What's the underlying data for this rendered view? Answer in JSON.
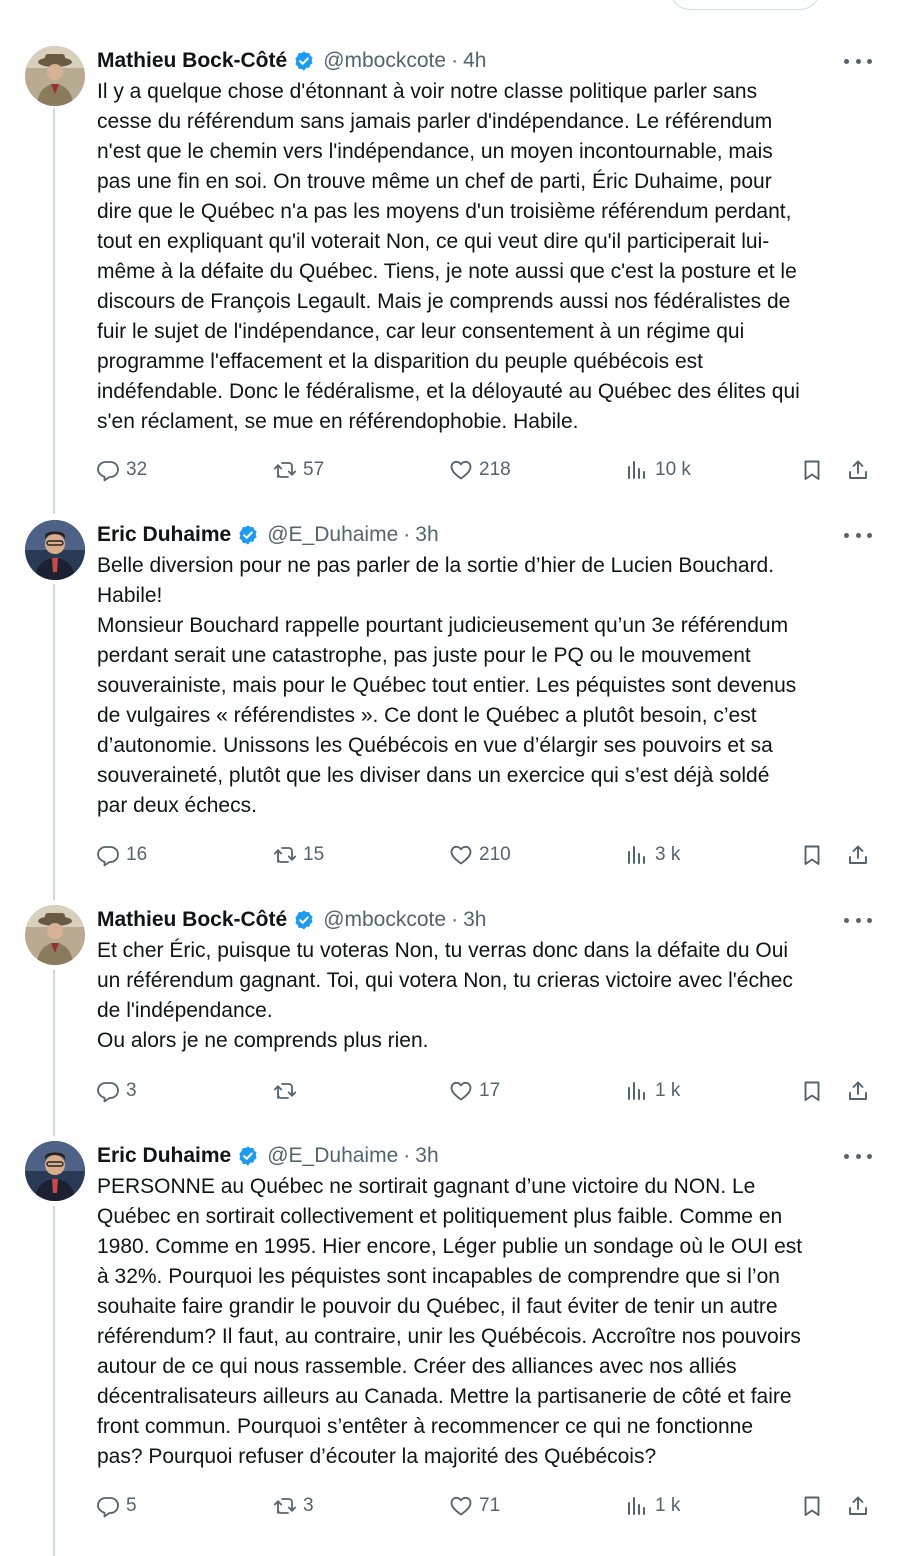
{
  "tweets": [
    {
      "author": "Mathieu Bock-Côté",
      "handle": "@mbockcote",
      "time": "4h",
      "lines": [
        "Il y a quelque chose d'étonnant à voir notre classe politique parler sans",
        "cesse du référendum sans jamais parler d'indépendance. Le référendum",
        "n'est que le chemin vers l'indépendance, un moyen incontournable, mais",
        "pas une fin en soi.  On trouve même un chef de parti, Éric Duhaime, pour",
        "dire que le Québec n'a pas les moyens d'un troisième référendum perdant,",
        "tout en expliquant qu'il voterait Non, ce qui veut dire qu'il participerait lui-",
        "même à la défaite du Québec. Tiens, je note aussi que c'est la posture et le",
        "discours de François Legault. Mais je comprends aussi nos fédéralistes de",
        "fuir le sujet de l'indépendance, car leur consentement à un régime qui",
        "programme l'effacement et la disparition du peuple québécois est",
        "indéfendable. Donc le fédéralisme, et la déloyauté au Québec des élites qui",
        "s'en réclament, se mue en référendophobie. Habile."
      ],
      "replies": "32",
      "reposts": "57",
      "likes": "218",
      "views": "10 k"
    },
    {
      "author": "Eric Duhaime",
      "handle": "@E_Duhaime",
      "time": "3h",
      "lines": [
        "Belle diversion pour ne pas parler de la sortie d’hier de Lucien Bouchard.",
        "Habile!",
        "Monsieur Bouchard rappelle pourtant judicieusement qu’un 3e référendum",
        "perdant serait une catastrophe, pas juste pour le PQ ou le mouvement",
        "souverainiste, mais pour le Québec tout entier. Les péquistes sont devenus",
        "de vulgaires « référendistes ». Ce dont le Québec a plutôt besoin, c’est",
        "d’autonomie. Unissons les Québécois en vue d’élargir ses pouvoirs et sa",
        "souveraineté, plutôt que les diviser dans un exercice qui s’est déjà soldé",
        "par deux échecs."
      ],
      "replies": "16",
      "reposts": "15",
      "likes": "210",
      "views": "3 k"
    },
    {
      "author": "Mathieu Bock-Côté",
      "handle": "@mbockcote",
      "time": "3h",
      "lines": [
        "Et cher Éric, puisque tu voteras Non, tu verras donc dans la défaite du Oui",
        "un référendum gagnant. Toi, qui votera Non, tu crieras victoire avec l'échec",
        "de l'indépendance.",
        "Ou alors je ne comprends plus rien."
      ],
      "replies": "3",
      "reposts": "",
      "likes": "17",
      "views": "1 k"
    },
    {
      "author": "Eric Duhaime",
      "handle": "@E_Duhaime",
      "time": "3h",
      "lines": [
        "PERSONNE au Québec ne sortirait gagnant d’une victoire du NON. Le",
        "Québec en sortirait collectivement et politiquement plus faible. Comme en",
        "1980. Comme en 1995. Hier encore, Léger publie un sondage où le OUI est",
        "à 32%. Pourquoi les péquistes sont incapables de comprendre que si l’on",
        "souhaite faire grandir le pouvoir du Québec, il faut éviter de tenir un autre",
        "référendum? Il faut, au contraire, unir les Québécois. Accroître nos pouvoirs",
        "autour de ce qui nous rassemble. Créer des alliances avec nos alliés",
        "décentralisateurs ailleurs au Canada. Mettre la partisanerie de côté et faire",
        "front commun. Pourquoi s’entêter à recommencer ce qui ne fonctionne",
        "pas? Pourquoi refuser d’écouter la majorité des Québécois?"
      ],
      "replies": "5",
      "reposts": "3",
      "likes": "71",
      "views": "1 k"
    }
  ],
  "icons": {
    "reply": "reply-icon",
    "repost": "repost-icon",
    "like": "heart-icon",
    "views": "views-icon",
    "bookmark": "bookmark-icon",
    "share": "share-icon",
    "verified": "verified-badge-icon",
    "more": "more-icon"
  },
  "colors": {
    "text": "#0f1419",
    "secondary": "#536471",
    "verified": "#1d9bf0",
    "thread_line": "#cfd9de"
  }
}
